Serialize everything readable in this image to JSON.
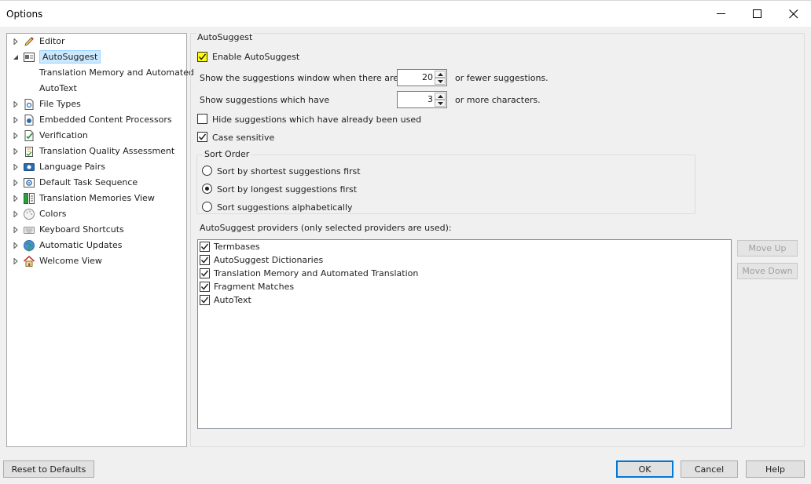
{
  "window": {
    "title": "Options"
  },
  "tree": {
    "items": [
      {
        "label": "Editor",
        "icon": "pencil-icon"
      },
      {
        "label": "AutoSuggest",
        "icon": "autosuggest-icon"
      },
      {
        "label": "Translation Memory and Automated"
      },
      {
        "label": "AutoText"
      },
      {
        "label": "File Types",
        "icon": "file-types-icon"
      },
      {
        "label": "Embedded Content Processors",
        "icon": "embedded-content-icon"
      },
      {
        "label": "Verification",
        "icon": "verification-icon"
      },
      {
        "label": "Translation Quality Assessment",
        "icon": "tqa-icon"
      },
      {
        "label": "Language Pairs",
        "icon": "language-pairs-icon"
      },
      {
        "label": "Default Task Sequence",
        "icon": "task-sequence-icon"
      },
      {
        "label": "Translation Memories View",
        "icon": "tm-view-icon"
      },
      {
        "label": "Colors",
        "icon": "palette-icon"
      },
      {
        "label": "Keyboard Shortcuts",
        "icon": "keyboard-icon"
      },
      {
        "label": "Automatic Updates",
        "icon": "globe-update-icon"
      },
      {
        "label": "Welcome View",
        "icon": "house-icon"
      }
    ]
  },
  "autosuggest": {
    "section_title": "AutoSuggest",
    "enable_label": "Enable AutoSuggest",
    "enable_checked": true,
    "window_prefix": "Show the suggestions window when there are",
    "window_value": "20",
    "window_suffix": "or fewer suggestions.",
    "chars_prefix": "Show suggestions which have",
    "chars_value": "3",
    "chars_suffix": "or more characters.",
    "hide_used_label": "Hide suggestions which have already been used",
    "hide_used_checked": false,
    "case_label": "Case sensitive",
    "case_checked": true,
    "sort_order": {
      "title": "Sort Order",
      "options": [
        {
          "label": "Sort by shortest suggestions first",
          "selected": false
        },
        {
          "label": "Sort by longest suggestions first",
          "selected": true
        },
        {
          "label": "Sort suggestions alphabetically",
          "selected": false
        }
      ]
    },
    "providers_label": "AutoSuggest providers (only selected providers are used):",
    "providers": [
      {
        "label": "Termbases",
        "checked": true
      },
      {
        "label": "AutoSuggest Dictionaries",
        "checked": true
      },
      {
        "label": "Translation Memory and Automated Translation",
        "checked": true
      },
      {
        "label": "Fragment Matches",
        "checked": true
      },
      {
        "label": "AutoText",
        "checked": true
      }
    ],
    "move_up_label": "Move Up",
    "move_down_label": "Move Down"
  },
  "footer": {
    "reset_label": "Reset to Defaults",
    "ok_label": "OK",
    "cancel_label": "Cancel",
    "help_label": "Help"
  },
  "colors": {
    "highlight": "#ffff00",
    "selection": "#cce8ff",
    "accent": "#0078d7"
  }
}
